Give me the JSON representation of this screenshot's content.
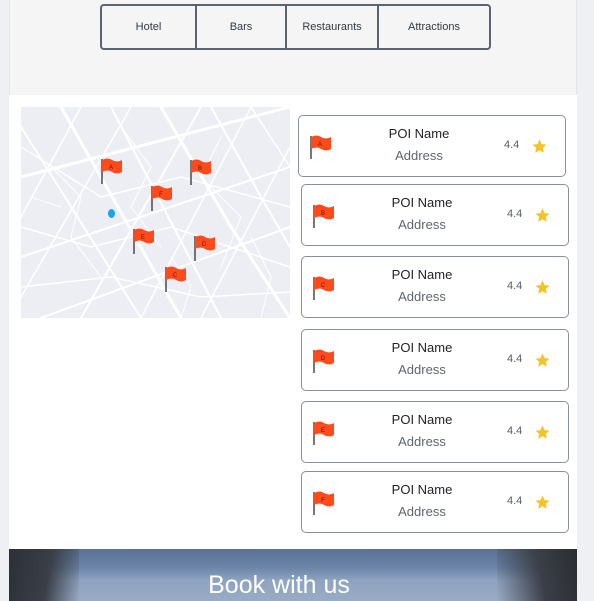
{
  "tabs": [
    {
      "label": "Hotel"
    },
    {
      "label": "Bars"
    },
    {
      "label": "Restaurants"
    },
    {
      "label": "Attractions"
    }
  ],
  "map": {
    "markers": [
      "A",
      "B",
      "C",
      "D",
      "E",
      "F"
    ],
    "flag_color": "#ff4a1c",
    "user_dot_color": "#1aa3f0"
  },
  "pois": [
    {
      "flag_letter": "A",
      "name": "POI Name",
      "address": "Address",
      "rating": "4.4"
    },
    {
      "flag_letter": "B",
      "name": "POI Name",
      "address": "Address",
      "rating": "4.4"
    },
    {
      "flag_letter": "C",
      "name": "POI Name",
      "address": "Address",
      "rating": "4.4"
    },
    {
      "flag_letter": "D",
      "name": "POI Name",
      "address": "Address",
      "rating": "4.4"
    },
    {
      "flag_letter": "E",
      "name": "POI Name",
      "address": "Address",
      "rating": "4.4"
    },
    {
      "flag_letter": "F",
      "name": "POI Name",
      "address": "Address",
      "rating": "4.4"
    }
  ],
  "colors": {
    "flag": "#ff4a1c",
    "star": "#f6c325",
    "border": "#8a9099"
  },
  "banner": {
    "title": "Book with us"
  }
}
